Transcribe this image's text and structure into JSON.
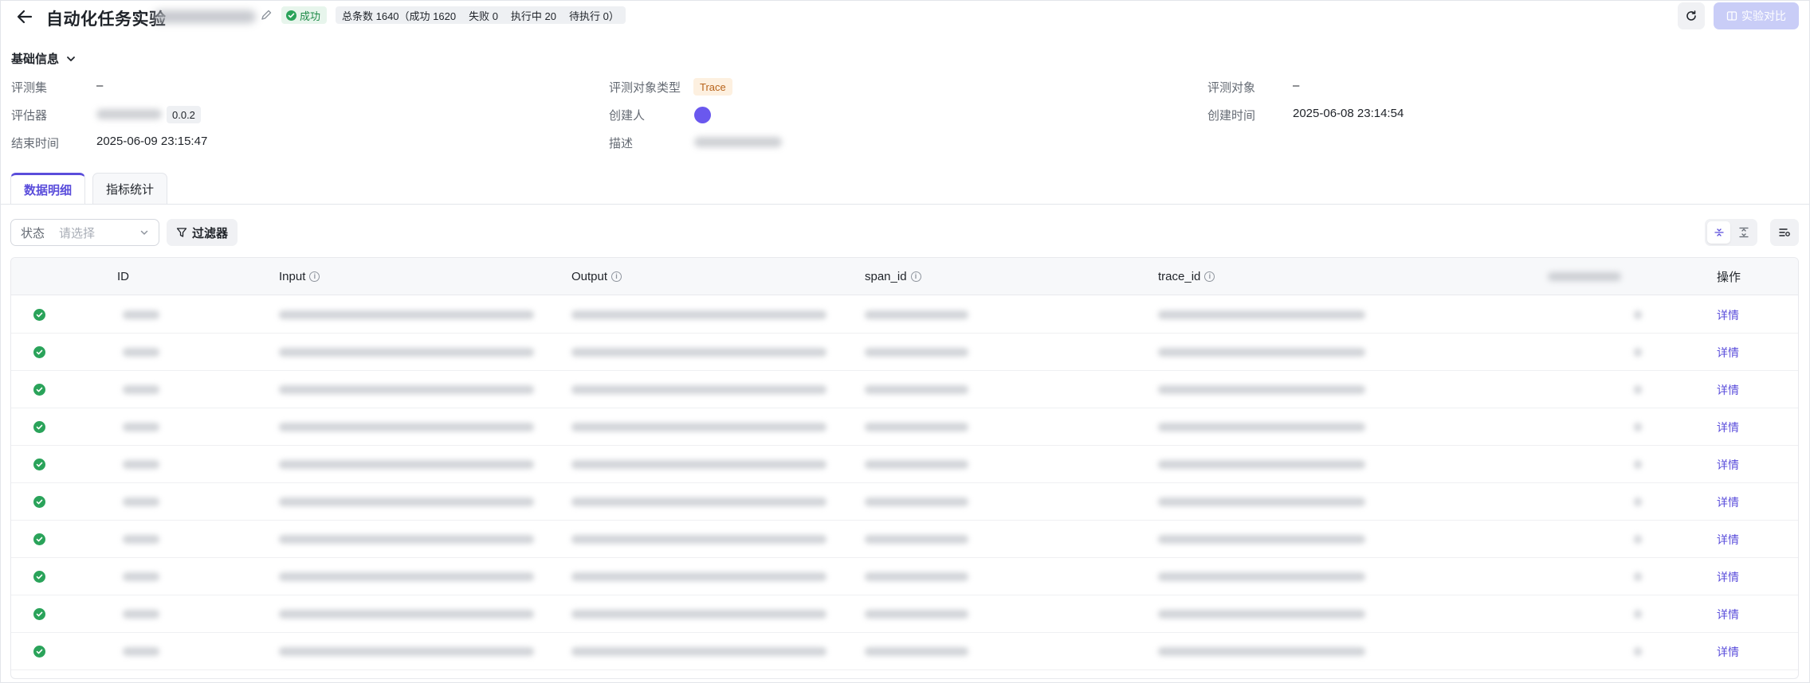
{
  "header": {
    "title": "自动化任务实验",
    "status": "成功",
    "counts": [
      "总条数 1640（成功 1620",
      "失败 0",
      "执行中 20",
      "待执行 0）"
    ],
    "compare_label": "实验对比"
  },
  "basic_info": {
    "section_title": "基础信息",
    "fields": {
      "dataset_label": "评测集",
      "dataset_value": "–",
      "target_type_label": "评测对象类型",
      "target_type_value": "Trace",
      "target_label": "评测对象",
      "target_value": "–",
      "evaluator_label": "评估器",
      "evaluator_version": "0.0.2",
      "creator_label": "创建人",
      "created_time_label": "创建时间",
      "created_time_value": "2025-06-08 23:14:54",
      "end_time_label": "结束时间",
      "end_time_value": "2025-06-09 23:15:47",
      "desc_label": "描述"
    }
  },
  "tabs": [
    {
      "label": "数据明细",
      "active": true
    },
    {
      "label": "指标统计",
      "active": false
    }
  ],
  "filters": {
    "status_label": "状态",
    "status_placeholder": "请选择",
    "filter_button": "过滤器"
  },
  "table": {
    "columns": [
      "ID",
      "Input",
      "Output",
      "span_id",
      "trace_id",
      "操作"
    ],
    "row_status": "success",
    "action_label": "详情",
    "row_count": 10
  },
  "colors": {
    "accent": "#5a4ddb",
    "success": "#2aa35a",
    "trace_tag_bg": "#fdf0e0",
    "trace_tag_text": "#b8641c"
  },
  "icons": [
    "back-arrow-icon",
    "edit-pencil-icon",
    "check-circle-icon",
    "refresh-icon",
    "compare-icon",
    "chevron-down-icon",
    "filter-icon",
    "info-icon",
    "density-compact-icon",
    "density-expand-icon",
    "column-settings-icon"
  ]
}
